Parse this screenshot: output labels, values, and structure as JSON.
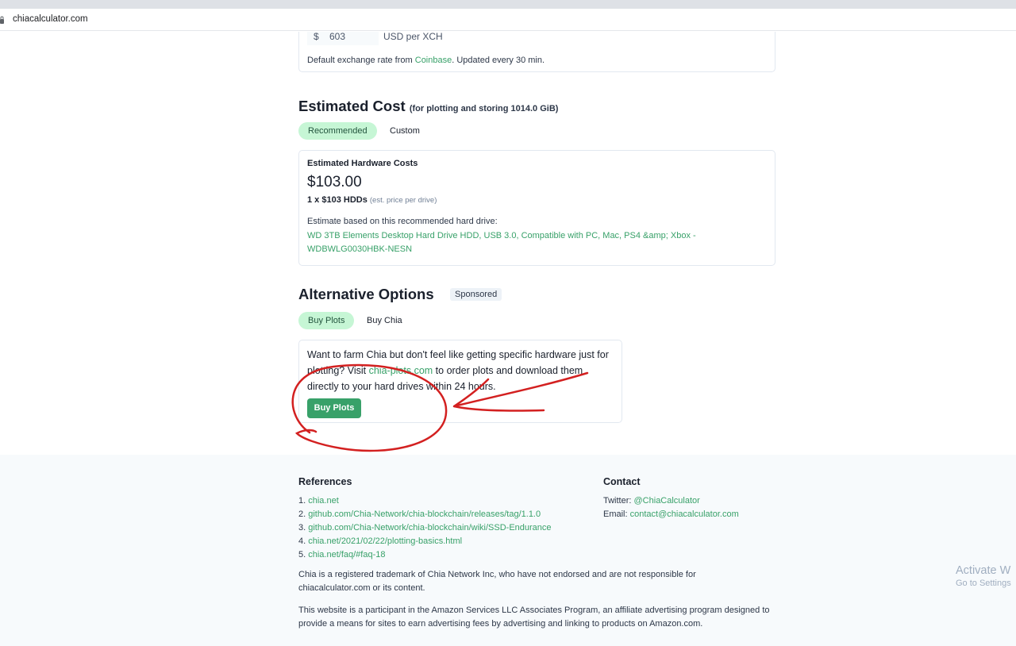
{
  "browser": {
    "url": "chiacalculator.com"
  },
  "exchange": {
    "currency_symbol": "$",
    "rate_value": "603",
    "unit": "USD per XCH",
    "note_prefix": "Default exchange rate from ",
    "note_link": "Coinbase",
    "note_suffix": ". Updated every 30 min."
  },
  "estimated_cost": {
    "title": "Estimated Cost",
    "subtitle": "(for plotting and storing 1014.0 GiB)",
    "tabs": [
      "Recommended",
      "Custom"
    ],
    "hardware_label": "Estimated Hardware Costs",
    "price": "$103.00",
    "drives": "1 x $103 HDDs",
    "drives_note": "(est. price per drive)",
    "basis": "Estimate based on this recommended hard drive:",
    "drive_link": "WD 3TB Elements Desktop Hard Drive HDD, USB 3.0, Compatible with PC, Mac, PS4 &amp; Xbox - WDBWLG0030HBK-NESN"
  },
  "alternative": {
    "title": "Alternative Options",
    "badge": "Sponsored",
    "tabs": [
      "Buy Plots",
      "Buy Chia"
    ],
    "desc_prefix": "Want to farm Chia but don't feel like getting specific hardware just for plotting? Visit ",
    "desc_link": "chia-plots.com",
    "desc_suffix": " to order plots and download them directly to your hard drives within 24 hours.",
    "button": "Buy Plots"
  },
  "footer": {
    "references_title": "References",
    "references": [
      {
        "num": "1. ",
        "link": "chia.net"
      },
      {
        "num": "2. ",
        "link": "github.com/Chia-Network/chia-blockchain/releases/tag/1.1.0"
      },
      {
        "num": "3. ",
        "link": "github.com/Chia-Network/chia-blockchain/wiki/SSD-Endurance"
      },
      {
        "num": "4. ",
        "link": "chia.net/2021/02/22/plotting-basics.html"
      },
      {
        "num": "5. ",
        "link": "chia.net/faq/#faq-18"
      }
    ],
    "contact_title": "Contact",
    "twitter_label": "Twitter: ",
    "twitter_link": "@ChiaCalculator",
    "email_label": "Email: ",
    "email_link": "contact@chiacalculator.com",
    "trademark": "Chia is a registered trademark of Chia Network Inc, who have not endorsed and are not responsible for chiacalculator.com or its content.",
    "amazon": "This website is a participant in the Amazon Services LLC Associates Program, an affiliate advertising program designed to provide a means for sites to earn advertising fees by advertising and linking to products on Amazon.com."
  },
  "watermark": {
    "line1": "Activate W",
    "line2": "Go to Settings"
  },
  "colors": {
    "accent": "#38a169",
    "pill_active_bg": "#c6f6d5",
    "annotation": "#d32020"
  }
}
